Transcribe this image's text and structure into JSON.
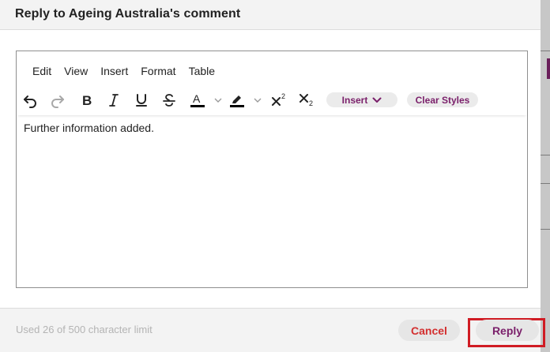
{
  "dialog": {
    "title": "Reply to Ageing Australia's comment"
  },
  "editor": {
    "menu": [
      "Edit",
      "View",
      "Insert",
      "Format",
      "Table"
    ],
    "toolbar": {
      "icons": [
        "undo-icon",
        "redo-icon",
        "bold-icon",
        "italic-icon",
        "underline-icon",
        "strikethrough-icon",
        "text-color-icon",
        "highlight-icon",
        "superscript-icon",
        "subscript-icon"
      ],
      "insert_label": "Insert",
      "clear_styles_label": "Clear Styles",
      "text_color": "#000000",
      "highlight_color": "#000000"
    },
    "content": "Further information added."
  },
  "footer": {
    "char_limit_text": "Used 26 of 500 character limit",
    "cancel_label": "Cancel",
    "reply_label": "Reply"
  },
  "colors": {
    "accent": "#7a1f6a",
    "cancel": "#d32f2f",
    "highlight_box": "#d01c24"
  }
}
